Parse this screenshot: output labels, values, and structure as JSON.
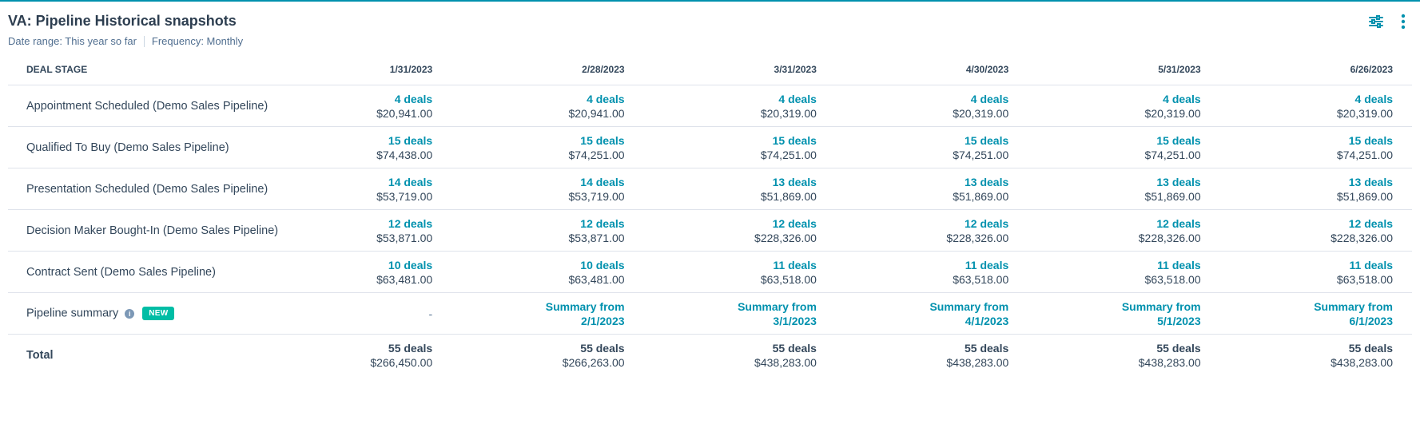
{
  "header": {
    "title": "VA: Pipeline Historical snapshots",
    "date_range": "Date range: This year so far",
    "frequency": "Frequency: Monthly",
    "icons": [
      "filter-sliders-icon",
      "more-vertical-icon"
    ]
  },
  "table": {
    "stage_header": "DEAL STAGE",
    "columns": [
      "1/31/2023",
      "2/28/2023",
      "3/31/2023",
      "4/30/2023",
      "5/31/2023",
      "6/26/2023"
    ],
    "rows": [
      {
        "stage": "Appointment Scheduled (Demo Sales Pipeline)",
        "cells": [
          {
            "deals": "4 deals",
            "amount": "$20,941.00"
          },
          {
            "deals": "4 deals",
            "amount": "$20,941.00"
          },
          {
            "deals": "4 deals",
            "amount": "$20,319.00"
          },
          {
            "deals": "4 deals",
            "amount": "$20,319.00"
          },
          {
            "deals": "4 deals",
            "amount": "$20,319.00"
          },
          {
            "deals": "4 deals",
            "amount": "$20,319.00"
          }
        ]
      },
      {
        "stage": "Qualified To Buy (Demo Sales Pipeline)",
        "cells": [
          {
            "deals": "15 deals",
            "amount": "$74,438.00"
          },
          {
            "deals": "15 deals",
            "amount": "$74,251.00"
          },
          {
            "deals": "15 deals",
            "amount": "$74,251.00"
          },
          {
            "deals": "15 deals",
            "amount": "$74,251.00"
          },
          {
            "deals": "15 deals",
            "amount": "$74,251.00"
          },
          {
            "deals": "15 deals",
            "amount": "$74,251.00"
          }
        ]
      },
      {
        "stage": "Presentation Scheduled (Demo Sales Pipeline)",
        "cells": [
          {
            "deals": "14 deals",
            "amount": "$53,719.00"
          },
          {
            "deals": "14 deals",
            "amount": "$53,719.00"
          },
          {
            "deals": "13 deals",
            "amount": "$51,869.00"
          },
          {
            "deals": "13 deals",
            "amount": "$51,869.00"
          },
          {
            "deals": "13 deals",
            "amount": "$51,869.00"
          },
          {
            "deals": "13 deals",
            "amount": "$51,869.00"
          }
        ]
      },
      {
        "stage": "Decision Maker Bought-In (Demo Sales Pipeline)",
        "cells": [
          {
            "deals": "12 deals",
            "amount": "$53,871.00"
          },
          {
            "deals": "12 deals",
            "amount": "$53,871.00"
          },
          {
            "deals": "12 deals",
            "amount": "$228,326.00"
          },
          {
            "deals": "12 deals",
            "amount": "$228,326.00"
          },
          {
            "deals": "12 deals",
            "amount": "$228,326.00"
          },
          {
            "deals": "12 deals",
            "amount": "$228,326.00"
          }
        ]
      },
      {
        "stage": "Contract Sent (Demo Sales Pipeline)",
        "cells": [
          {
            "deals": "10 deals",
            "amount": "$63,481.00"
          },
          {
            "deals": "10 deals",
            "amount": "$63,481.00"
          },
          {
            "deals": "11 deals",
            "amount": "$63,518.00"
          },
          {
            "deals": "11 deals",
            "amount": "$63,518.00"
          },
          {
            "deals": "11 deals",
            "amount": "$63,518.00"
          },
          {
            "deals": "11 deals",
            "amount": "$63,518.00"
          }
        ]
      }
    ],
    "summary": {
      "label": "Pipeline summary",
      "info_icon": "info-icon",
      "badge": "NEW",
      "cells": [
        {
          "line1": "-",
          "line2": ""
        },
        {
          "line1": "Summary from",
          "line2": "2/1/2023"
        },
        {
          "line1": "Summary from",
          "line2": "3/1/2023"
        },
        {
          "line1": "Summary from",
          "line2": "4/1/2023"
        },
        {
          "line1": "Summary from",
          "line2": "5/1/2023"
        },
        {
          "line1": "Summary from",
          "line2": "6/1/2023"
        }
      ]
    },
    "total": {
      "label": "Total",
      "cells": [
        {
          "deals": "55 deals",
          "amount": "$266,450.00"
        },
        {
          "deals": "55 deals",
          "amount": "$266,263.00"
        },
        {
          "deals": "55 deals",
          "amount": "$438,283.00"
        },
        {
          "deals": "55 deals",
          "amount": "$438,283.00"
        },
        {
          "deals": "55 deals",
          "amount": "$438,283.00"
        },
        {
          "deals": "55 deals",
          "amount": "$438,283.00"
        }
      ]
    }
  },
  "colors": {
    "accent": "#0091ae",
    "text": "#33475b",
    "badge": "#00bda5",
    "border": "#dfe3eb"
  }
}
